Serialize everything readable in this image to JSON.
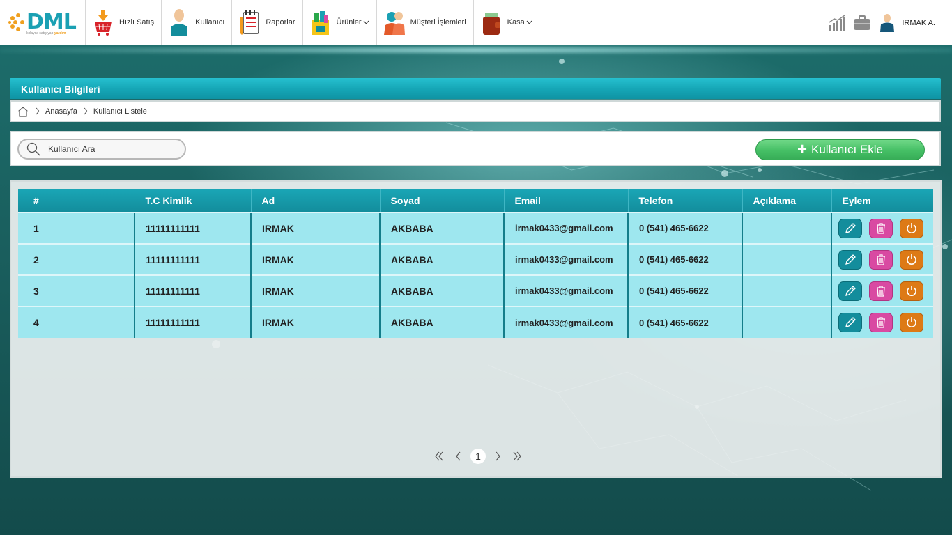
{
  "app": {
    "logo_text": "DML",
    "logo_subtitle": "kolayca satış yap",
    "logo_tag": "yazılım"
  },
  "nav": {
    "items": [
      {
        "label": "Hızlı Satış",
        "icon": "basket-icon"
      },
      {
        "label": "Kullanıcı",
        "icon": "user-icon"
      },
      {
        "label": "Raporlar",
        "icon": "notepad-icon"
      },
      {
        "label": "Ürünler",
        "icon": "shopping-bag-icon",
        "dropdown": true
      },
      {
        "label": "Müşteri İşlemleri",
        "icon": "customers-icon"
      },
      {
        "label": "Kasa",
        "icon": "wallet-icon",
        "dropdown": true
      }
    ],
    "right": {
      "stats_icon": "bar-chart-icon",
      "briefcase_icon": "briefcase-icon",
      "avatar_icon": "user-avatar-icon",
      "user_name": "IRMAK A."
    }
  },
  "page": {
    "title": "Kullanıcı Bilgileri",
    "breadcrumb": [
      "Anasayfa",
      "Kullanıcı Listele"
    ]
  },
  "search": {
    "placeholder": "Kullanıcı Ara"
  },
  "toolbar": {
    "add_label": "Kullanıcı Ekle"
  },
  "table": {
    "headers": [
      "#",
      "T.C Kimlik",
      "Ad",
      "Soyad",
      "Email",
      "Telefon",
      "Açıklama",
      "Eylem"
    ],
    "rows": [
      {
        "no": "1",
        "tc": "11111111111",
        "ad": "IRMAK",
        "soyad": "AKBABA",
        "email": "irmak0433@gmail.com",
        "telefon": "0 (541) 465-6622",
        "aciklama": ""
      },
      {
        "no": "2",
        "tc": "11111111111",
        "ad": "IRMAK",
        "soyad": "AKBABA",
        "email": "irmak0433@gmail.com",
        "telefon": "0 (541) 465-6622",
        "aciklama": ""
      },
      {
        "no": "3",
        "tc": "11111111111",
        "ad": "IRMAK",
        "soyad": "AKBABA",
        "email": "irmak0433@gmail.com",
        "telefon": "0 (541) 465-6622",
        "aciklama": ""
      },
      {
        "no": "4",
        "tc": "11111111111",
        "ad": "IRMAK",
        "soyad": "AKBABA",
        "email": "irmak0433@gmail.com",
        "telefon": "0 (541) 465-6622",
        "aciklama": ""
      }
    ]
  },
  "pagination": {
    "current": "1"
  },
  "colors": {
    "accent": "#15a5b5",
    "row_bg": "#9ee7ef",
    "add_green": "#45bf65",
    "delete_pink": "#d94aa2",
    "reset_orange": "#dd7a16"
  }
}
